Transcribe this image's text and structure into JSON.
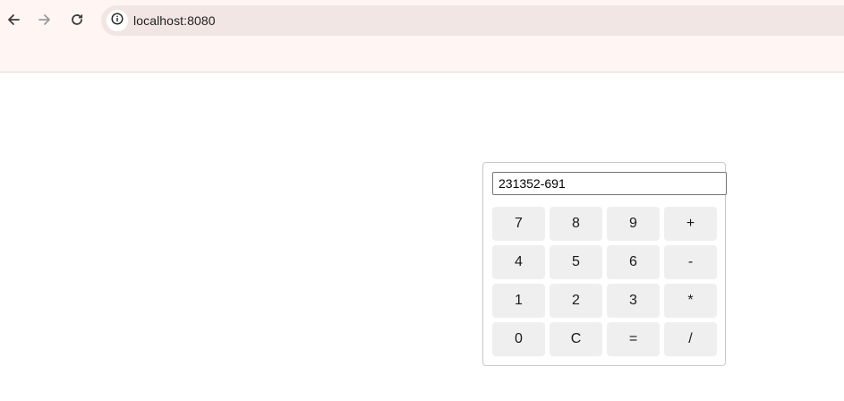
{
  "browser": {
    "url": "localhost:8080",
    "icons": {
      "back": "arrow-left-icon",
      "forward": "arrow-right-icon",
      "reload": "reload-icon",
      "site_info": "info-icon"
    }
  },
  "calculator": {
    "display_value": "231352-691",
    "keys": [
      [
        "7",
        "8",
        "9",
        "+"
      ],
      [
        "4",
        "5",
        "6",
        "-"
      ],
      [
        "1",
        "2",
        "3",
        "*"
      ],
      [
        "0",
        "C",
        "=",
        "/"
      ]
    ]
  },
  "colors": {
    "chrome_background": "#fff6f4",
    "omnibox_background": "#f1e6e3",
    "key_background": "#efefef"
  }
}
